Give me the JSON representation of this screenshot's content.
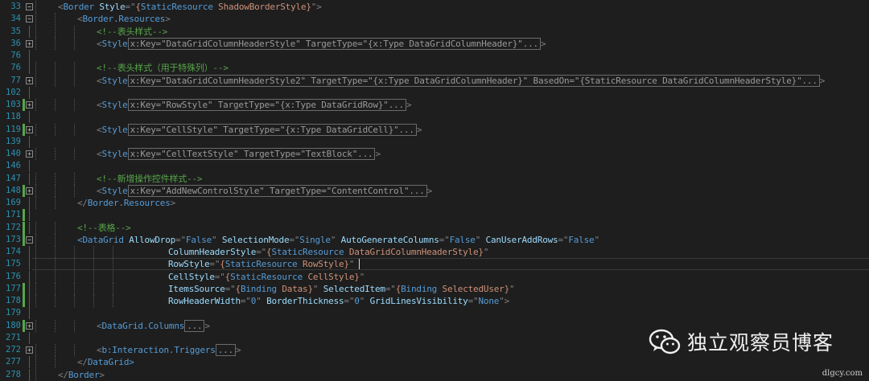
{
  "editor": {
    "lines": [
      {
        "num": "33",
        "marker": "",
        "fold": "minus",
        "indent": 1,
        "segs": [
          [
            "b",
            "<"
          ],
          [
            "t",
            "Border"
          ],
          [
            "a",
            " Style"
          ],
          [
            "b",
            "=\""
          ],
          [
            "v",
            "{"
          ],
          [
            "k",
            "StaticResource"
          ],
          [
            "v",
            " ShadowBorderStyle}"
          ],
          [
            "b",
            "\">"
          ]
        ]
      },
      {
        "num": "34",
        "marker": "",
        "fold": "minus",
        "indent": 2,
        "segs": [
          [
            "b",
            "<"
          ],
          [
            "t",
            "Border.Resources"
          ],
          [
            "b",
            ">"
          ]
        ]
      },
      {
        "num": "35",
        "marker": "",
        "fold": "",
        "indent": 3,
        "segs": [
          [
            "c",
            "<!--表头样式-->"
          ]
        ]
      },
      {
        "num": "36",
        "marker": "",
        "fold": "plus",
        "indent": 3,
        "segs": [
          [
            "b",
            "<"
          ],
          [
            "t",
            "Style"
          ],
          [
            "box",
            "x:Key=\"DataGridColumnHeaderStyle\" TargetType=\"{x:Type DataGridColumnHeader}\"..."
          ],
          [
            "b",
            ">"
          ]
        ]
      },
      {
        "num": "76",
        "marker": "",
        "fold": "",
        "indent": 0,
        "segs": []
      },
      {
        "num": "76",
        "marker": "",
        "fold": "",
        "indent": 3,
        "segs": [
          [
            "c",
            "<!--表头样式（用于特殊列）-->"
          ]
        ]
      },
      {
        "num": "77",
        "marker": "",
        "fold": "plus",
        "indent": 3,
        "segs": [
          [
            "b",
            "<"
          ],
          [
            "t",
            "Style"
          ],
          [
            "box",
            "x:Key=\"DataGridColumnHeaderStyle2\" TargetType=\"{x:Type DataGridColumnHeader}\" BasedOn=\"{StaticResource DataGridColumnHeaderStyle}\"..."
          ],
          [
            "b",
            ">"
          ]
        ]
      },
      {
        "num": "102",
        "marker": "",
        "fold": "",
        "indent": 0,
        "segs": []
      },
      {
        "num": "103",
        "marker": "green",
        "fold": "plus",
        "indent": 3,
        "segs": [
          [
            "b",
            "<"
          ],
          [
            "t",
            "Style"
          ],
          [
            "box",
            "x:Key=\"RowStyle\" TargetType=\"{x:Type DataGridRow}\"..."
          ],
          [
            "b",
            ">"
          ]
        ]
      },
      {
        "num": "118",
        "marker": "",
        "fold": "",
        "indent": 0,
        "segs": []
      },
      {
        "num": "119",
        "marker": "green",
        "fold": "plus",
        "indent": 3,
        "segs": [
          [
            "b",
            "<"
          ],
          [
            "t",
            "Style"
          ],
          [
            "box",
            "x:Key=\"CellStyle\" TargetType=\"{x:Type DataGridCell}\"..."
          ],
          [
            "b",
            ">"
          ]
        ]
      },
      {
        "num": "139",
        "marker": "",
        "fold": "",
        "indent": 0,
        "segs": []
      },
      {
        "num": "140",
        "marker": "",
        "fold": "plus",
        "indent": 3,
        "segs": [
          [
            "b",
            "<"
          ],
          [
            "t",
            "Style"
          ],
          [
            "box",
            "x:Key=\"CellTextStyle\" TargetType=\"TextBlock\"..."
          ],
          [
            "b",
            ">"
          ]
        ]
      },
      {
        "num": "146",
        "marker": "",
        "fold": "",
        "indent": 0,
        "segs": []
      },
      {
        "num": "147",
        "marker": "",
        "fold": "",
        "indent": 3,
        "segs": [
          [
            "c",
            "<!--新增操作控件样式-->"
          ]
        ]
      },
      {
        "num": "148",
        "marker": "green",
        "fold": "plus",
        "indent": 3,
        "segs": [
          [
            "b",
            "<"
          ],
          [
            "t",
            "Style"
          ],
          [
            "box",
            "x:Key=\"AddNewControlStyle\" TargetType=\"ContentControl\"..."
          ],
          [
            "b",
            ">"
          ]
        ]
      },
      {
        "num": "169",
        "marker": "",
        "fold": "",
        "indent": 2,
        "segs": [
          [
            "b",
            "</"
          ],
          [
            "t",
            "Border.Resources"
          ],
          [
            "b",
            ">"
          ]
        ]
      },
      {
        "num": "171",
        "marker": "green",
        "fold": "",
        "indent": 0,
        "segs": []
      },
      {
        "num": "172",
        "marker": "green",
        "fold": "",
        "indent": 2,
        "segs": [
          [
            "c",
            "<!--表格-->"
          ]
        ]
      },
      {
        "num": "173",
        "marker": "green",
        "fold": "minus",
        "indent": 2,
        "segs": [
          [
            "t",
            "<"
          ],
          [
            "t",
            "DataGrid"
          ],
          [
            "a",
            " AllowDrop"
          ],
          [
            "b",
            "=\""
          ],
          [
            "k",
            "False"
          ],
          [
            "b",
            "\""
          ],
          [
            "a",
            " SelectionMode"
          ],
          [
            "b",
            "=\""
          ],
          [
            "k",
            "Single"
          ],
          [
            "b",
            "\""
          ],
          [
            "a",
            " AutoGenerateColumns"
          ],
          [
            "b",
            "=\""
          ],
          [
            "k",
            "False"
          ],
          [
            "b",
            "\""
          ],
          [
            "a",
            " CanUserAddRows"
          ],
          [
            "b",
            "=\""
          ],
          [
            "k",
            "False"
          ],
          [
            "b",
            "\""
          ]
        ]
      },
      {
        "num": "174",
        "marker": "",
        "fold": "",
        "indent": 5,
        "segs": [
          [
            "a",
            "ColumnHeaderStyle"
          ],
          [
            "b",
            "=\""
          ],
          [
            "v",
            "{"
          ],
          [
            "k",
            "StaticResource"
          ],
          [
            "v",
            " DataGridColumnHeaderStyle}"
          ],
          [
            "b",
            "\""
          ]
        ]
      },
      {
        "num": "175",
        "marker": "",
        "fold": "",
        "indent": 5,
        "current": true,
        "segs": [
          [
            "a",
            "RowStyle"
          ],
          [
            "b",
            "=\""
          ],
          [
            "v",
            "{"
          ],
          [
            "k",
            "StaticResource"
          ],
          [
            "v",
            " RowStyle}"
          ],
          [
            "b",
            "\""
          ]
        ]
      },
      {
        "num": "176",
        "marker": "",
        "fold": "",
        "indent": 5,
        "segs": [
          [
            "a",
            "CellStyle"
          ],
          [
            "b",
            "=\""
          ],
          [
            "v",
            "{"
          ],
          [
            "k",
            "StaticResource"
          ],
          [
            "v",
            " CellStyle}"
          ],
          [
            "b",
            "\""
          ]
        ]
      },
      {
        "num": "177",
        "marker": "green",
        "fold": "",
        "indent": 5,
        "segs": [
          [
            "a",
            "ItemsSource"
          ],
          [
            "b",
            "=\""
          ],
          [
            "v",
            "{"
          ],
          [
            "k",
            "Binding"
          ],
          [
            "v",
            " Datas}"
          ],
          [
            "b",
            "\""
          ],
          [
            "a",
            " SelectedItem"
          ],
          [
            "b",
            "=\""
          ],
          [
            "v",
            "{"
          ],
          [
            "k",
            "Binding"
          ],
          [
            "v",
            " SelectedUser}"
          ],
          [
            "b",
            "\""
          ]
        ]
      },
      {
        "num": "178",
        "marker": "green",
        "fold": "",
        "indent": 5,
        "segs": [
          [
            "a",
            "RowHeaderWidth"
          ],
          [
            "b",
            "=\""
          ],
          [
            "k",
            "0"
          ],
          [
            "b",
            "\""
          ],
          [
            "a",
            " BorderThickness"
          ],
          [
            "b",
            "=\""
          ],
          [
            "k",
            "0"
          ],
          [
            "b",
            "\""
          ],
          [
            "a",
            " GridLinesVisibility"
          ],
          [
            "b",
            "=\""
          ],
          [
            "k",
            "None"
          ],
          [
            "b",
            "\">"
          ]
        ]
      },
      {
        "num": "179",
        "marker": "",
        "fold": "",
        "indent": 0,
        "segs": []
      },
      {
        "num": "180",
        "marker": "green",
        "fold": "plus",
        "indent": 3,
        "segs": [
          [
            "b",
            "<"
          ],
          [
            "t",
            "DataGrid.Columns"
          ],
          [
            "box",
            "..."
          ],
          [
            "b",
            ">"
          ]
        ]
      },
      {
        "num": "271",
        "marker": "",
        "fold": "",
        "indent": 0,
        "segs": []
      },
      {
        "num": "272",
        "marker": "",
        "fold": "plus",
        "indent": 3,
        "segs": [
          [
            "b",
            "<"
          ],
          [
            "t",
            "b:Interaction.Triggers"
          ],
          [
            "box",
            "..."
          ],
          [
            "b",
            ">"
          ]
        ]
      },
      {
        "num": "277",
        "marker": "",
        "fold": "",
        "indent": 2,
        "segs": [
          [
            "b",
            "</"
          ],
          [
            "t",
            "DataGrid"
          ],
          [
            "t",
            ">"
          ]
        ]
      },
      {
        "num": "278",
        "marker": "",
        "fold": "",
        "indent": 1,
        "segs": [
          [
            "b",
            "</"
          ],
          [
            "t",
            "Border"
          ],
          [
            "b",
            ">"
          ]
        ]
      }
    ]
  },
  "colors": {
    "background": "#1e1e1e",
    "line_number": "#2b91af",
    "change_marker": "#57a64a",
    "bracket": "#808080",
    "tag": "#569cd6",
    "attribute": "#9cdcfe",
    "value": "#ce9178",
    "comment": "#57a64a"
  },
  "watermark": {
    "icon": "wechat-icon",
    "text": "独立观察员博客",
    "site": "dlgcy.com"
  }
}
